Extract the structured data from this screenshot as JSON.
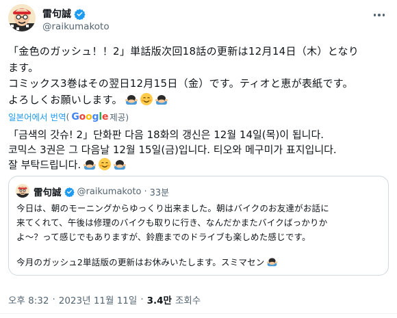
{
  "author": {
    "display_name": "雷句誠",
    "handle": "@raikumakoto",
    "verified_icon": "verified-badge-icon",
    "accent": "#1d9bf0"
  },
  "tweet": {
    "jp_lines": [
      "「金色のガッシュ！！2」単話版次回18話の更新は12月14日（木）となり",
      "ます。",
      "コミックス3巻はその翌日12月15日（金）です。ティオと恵が表紙です。",
      "よろしくお願いします。"
    ],
    "translate": {
      "label": "일본어에서 번역",
      "paren_open": "(",
      "provider": "Google",
      "provided": " 제공)"
    },
    "kr_lines": [
      "「금색의 갓슈! 2」단화판 다음 18화의 갱신은 12월 14일(목)이 됩니다.",
      "코믹스 3권은 그 다음날 12월 15일(금)입니다. 티오와 메구미가 표지입니다.",
      "잘 부탁드립니다."
    ]
  },
  "quoted": {
    "display_name": "雷句誠",
    "handle": "@raikumakoto",
    "separator": "·",
    "time": "33분",
    "lines": [
      "今日は、朝のモーニングからゆっくり出来ました。朝はバイクのお友達がお話に",
      "来てくれて、午後は修理のバイクも取りに行き、なんだかまたバイクばっかりか",
      "よ〜？って感じでもありますが、鈴鹿までのドライブも楽しめた感じです。"
    ],
    "line_after_gap": "今月のガッシュ2単話版の更新はお休みいたします。スミマセン"
  },
  "meta": {
    "time": "오후 8:32",
    "sep1": "·",
    "date": "2023년 11월 11일",
    "sep2": "·",
    "views_count": "3.4만",
    "views_label": "조회수"
  },
  "colors": {
    "text": "#0f1419",
    "secondary": "#536471",
    "link": "#1d9bf0",
    "border": "#cfd9de"
  }
}
